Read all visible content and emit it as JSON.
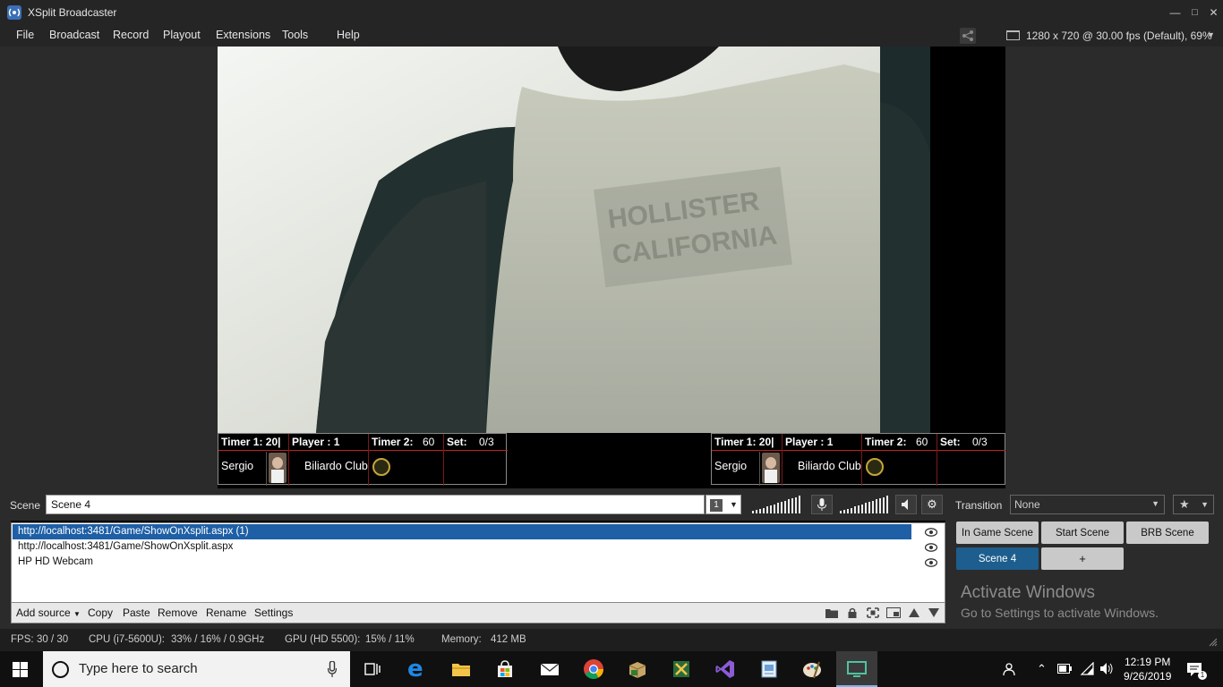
{
  "window": {
    "title": "XSplit Broadcaster",
    "controls": [
      "—",
      "☐",
      "✕"
    ]
  },
  "menu": {
    "items": [
      "File",
      "Broadcast",
      "Record",
      "Playout",
      "Extensions",
      "Tools",
      "Help"
    ],
    "resolution": "1280 x 720 @ 30.00 fps (Default), 69%"
  },
  "stage": {
    "hud_left": {
      "timer1": "Timer 1: 20|",
      "player": "Player : 1",
      "timer2_label": "Timer 2:",
      "timer2_value": "60",
      "set_label": "Set:",
      "set_value": "0/3",
      "name": "Sergio",
      "club": "Biliardo Club"
    },
    "hud_right": {
      "timer1": "Timer 1: 20|",
      "player": "Player : 1",
      "timer2_label": "Timer 2:",
      "timer2_value": "60",
      "set_label": "Set:",
      "set_value": "0/3",
      "name": "Sergio",
      "club": "Biliardo Club"
    },
    "shirt_text_line1": "HOLLISTER",
    "shirt_text_line2": "CALIFORNIA"
  },
  "scene": {
    "label": "Scene",
    "name": "Scene 4",
    "number": "1",
    "transition_label": "Transition",
    "transition_value": "None"
  },
  "sources": [
    {
      "label": "http://localhost:3481/Game/ShowOnXsplit.aspx (1)",
      "selected": true
    },
    {
      "label": "http://localhost:3481/Game/ShowOnXsplit.aspx",
      "selected": false
    },
    {
      "label": "HP HD Webcam",
      "selected": false
    }
  ],
  "source_toolbar": {
    "add_source": "Add source",
    "copy": "Copy",
    "paste": "Paste",
    "remove": "Remove",
    "rename": "Rename",
    "settings": "Settings"
  },
  "scene_buttons": {
    "in_game": "In Game Scene",
    "start": "Start Scene",
    "brb": "BRB Scene",
    "scene4": "Scene 4",
    "add": "+"
  },
  "activate": {
    "line1": "Activate Windows",
    "line2": "Go to Settings to activate Windows."
  },
  "status": {
    "fps_label": "FPS:",
    "fps_value": "30 / 30",
    "cpu_label": "CPU (i7-5600U):",
    "cpu_value": "33% / 16% / 0.9GHz",
    "gpu_label": "GPU (HD 5500):",
    "gpu_value": "15% / 11%",
    "memory_label": "Memory:",
    "memory_value": "412 MB"
  },
  "taskbar": {
    "search_placeholder": "Type here to search",
    "time": "12:19 PM",
    "date": "9/26/2019"
  },
  "colors": {
    "accent": "#1d5e8e",
    "selected_row": "#1e5fa6",
    "hud_red": "#c0201f"
  }
}
